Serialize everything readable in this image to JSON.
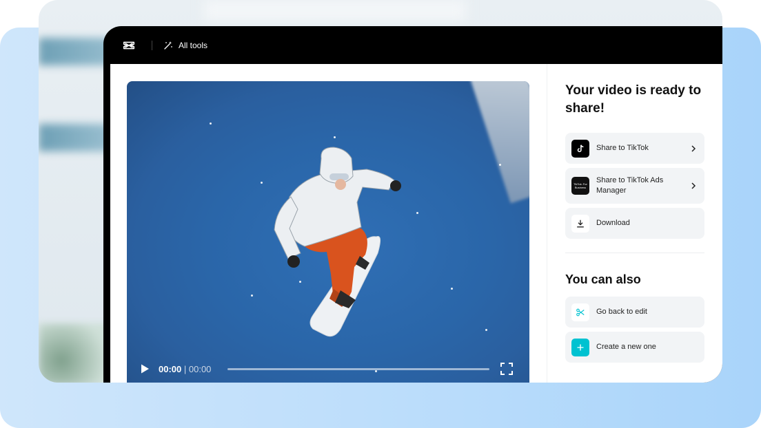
{
  "topbar": {
    "all_tools_label": "All tools"
  },
  "player": {
    "current_time": "00:00",
    "duration": "00:00",
    "progress": 0
  },
  "share": {
    "heading": "Your video is ready to share!",
    "options": [
      {
        "label": "Share to TikTok",
        "icon": "tiktok-icon"
      },
      {
        "label": "Share to TikTok Ads Manager",
        "icon": "tiktok-business-icon",
        "icon_text": "TikTok: For Business"
      },
      {
        "label": "Download",
        "icon": "download-icon"
      }
    ]
  },
  "also": {
    "heading": "You can also",
    "options": [
      {
        "label": "Go back to edit",
        "icon": "scissors-icon"
      },
      {
        "label": "Create a new one",
        "icon": "plus-icon"
      }
    ]
  },
  "colors": {
    "accent": "#00c2d1",
    "window": "#000000",
    "button_bg": "#f2f4f6"
  }
}
